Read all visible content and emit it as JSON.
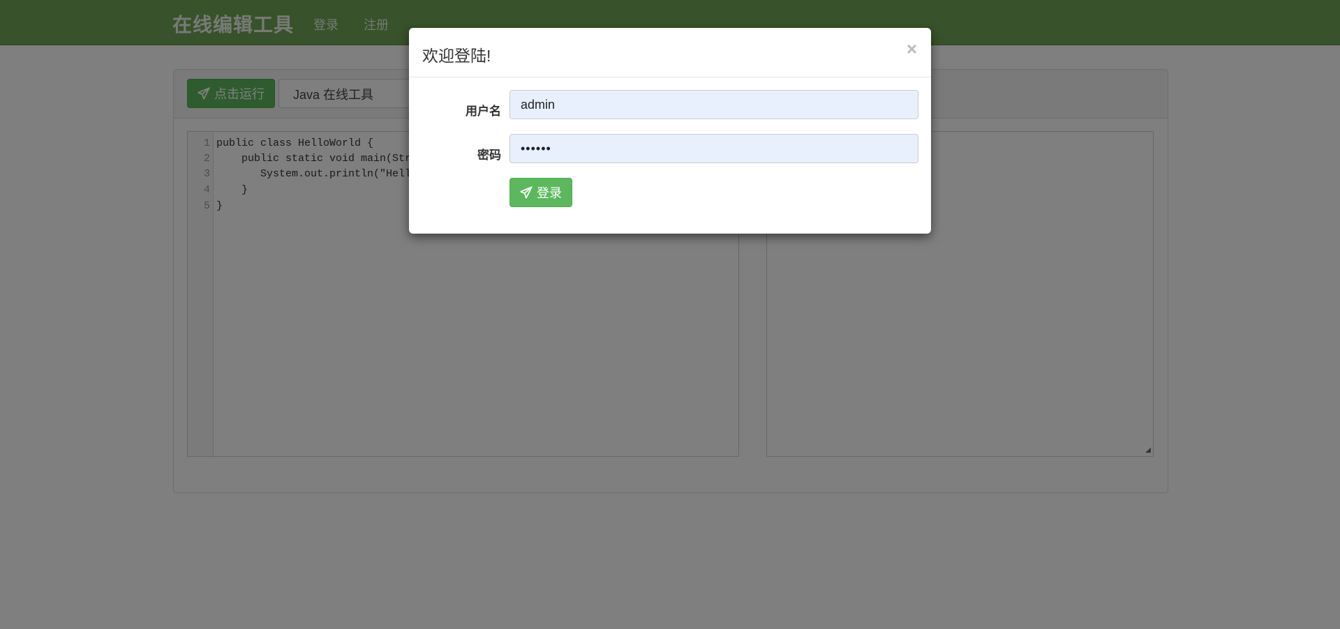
{
  "navbar": {
    "brand": "在线编辑工具",
    "links": [
      "登录",
      "注册"
    ]
  },
  "toolbar": {
    "run_label": "点击运行",
    "language": "Java 在线工具"
  },
  "editor": {
    "line_numbers": [
      "1",
      "2",
      "3",
      "4",
      "5"
    ],
    "code_lines": [
      "public class HelloWorld {",
      "    public static void main(Str",
      "       System.out.println(\"Hell",
      "    }",
      "}"
    ]
  },
  "modal": {
    "title": "欢迎登陆!",
    "close": "×",
    "username_label": "用户名",
    "username_value": "admin",
    "password_label": "密码",
    "password_value": "••••••",
    "login_label": "登录"
  },
  "colors": {
    "navbar": "#71a557",
    "button": "#5cb85c",
    "input_bg": "#e8f0fe"
  },
  "icons": {
    "run": "send-icon",
    "login": "send-icon",
    "close": "close-icon"
  }
}
